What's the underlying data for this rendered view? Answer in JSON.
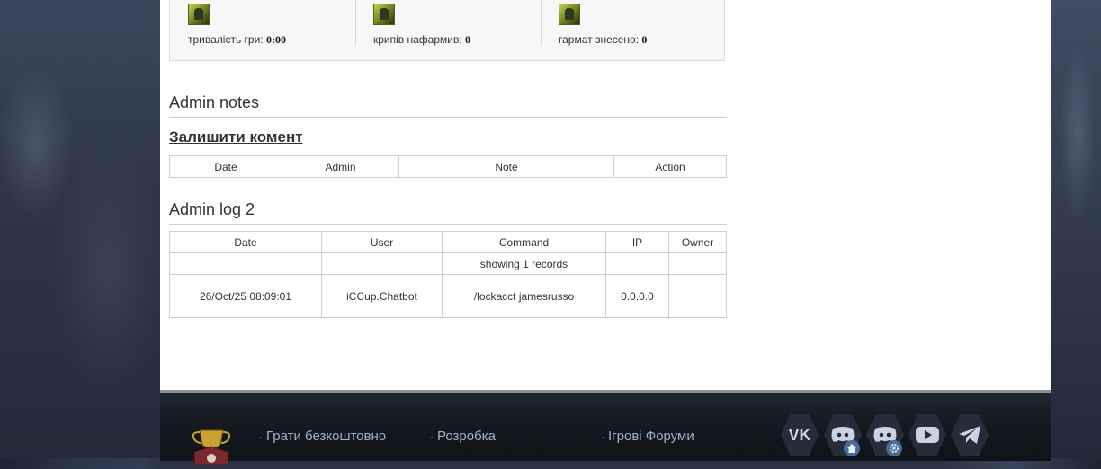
{
  "stats": [
    {
      "label": "тривалість гри:",
      "value": "0:00",
      "icon": "hero-portrait-icon"
    },
    {
      "label": "крипів нафармив:",
      "value": "0",
      "icon": "hero-portrait-icon"
    },
    {
      "label": "гармат знесено:",
      "value": "0",
      "icon": "hero-portrait-icon"
    }
  ],
  "admin_notes": {
    "heading": "Admin notes",
    "comment_link": "Залишити комент",
    "columns": [
      "Date",
      "Admin",
      "Note",
      "Action"
    ]
  },
  "admin_log": {
    "heading": "Admin log 2",
    "columns": [
      "Date",
      "User",
      "Command",
      "IP",
      "Owner"
    ],
    "summary": "showing 1 records",
    "rows": [
      {
        "date": "26/Oct/25 08:09:01",
        "user": "iCCup.Chatbot",
        "command": "/lockacct jamesrusso",
        "ip": "0.0.0.0",
        "owner": ""
      }
    ]
  },
  "footer": {
    "links": [
      "Грати безкоштовно",
      "Розробка",
      "Ігрові Форуми"
    ],
    "social": [
      "vk-icon",
      "discord-home-icon",
      "discord-settings-icon",
      "youtube-icon",
      "telegram-icon"
    ],
    "logo": "trophy-logo-icon"
  },
  "colors": {
    "footer_link": "#9fb3cc",
    "footer_bg": "#161a21",
    "social_bg": "#262d38",
    "icon_light": "#c8d3e3"
  }
}
